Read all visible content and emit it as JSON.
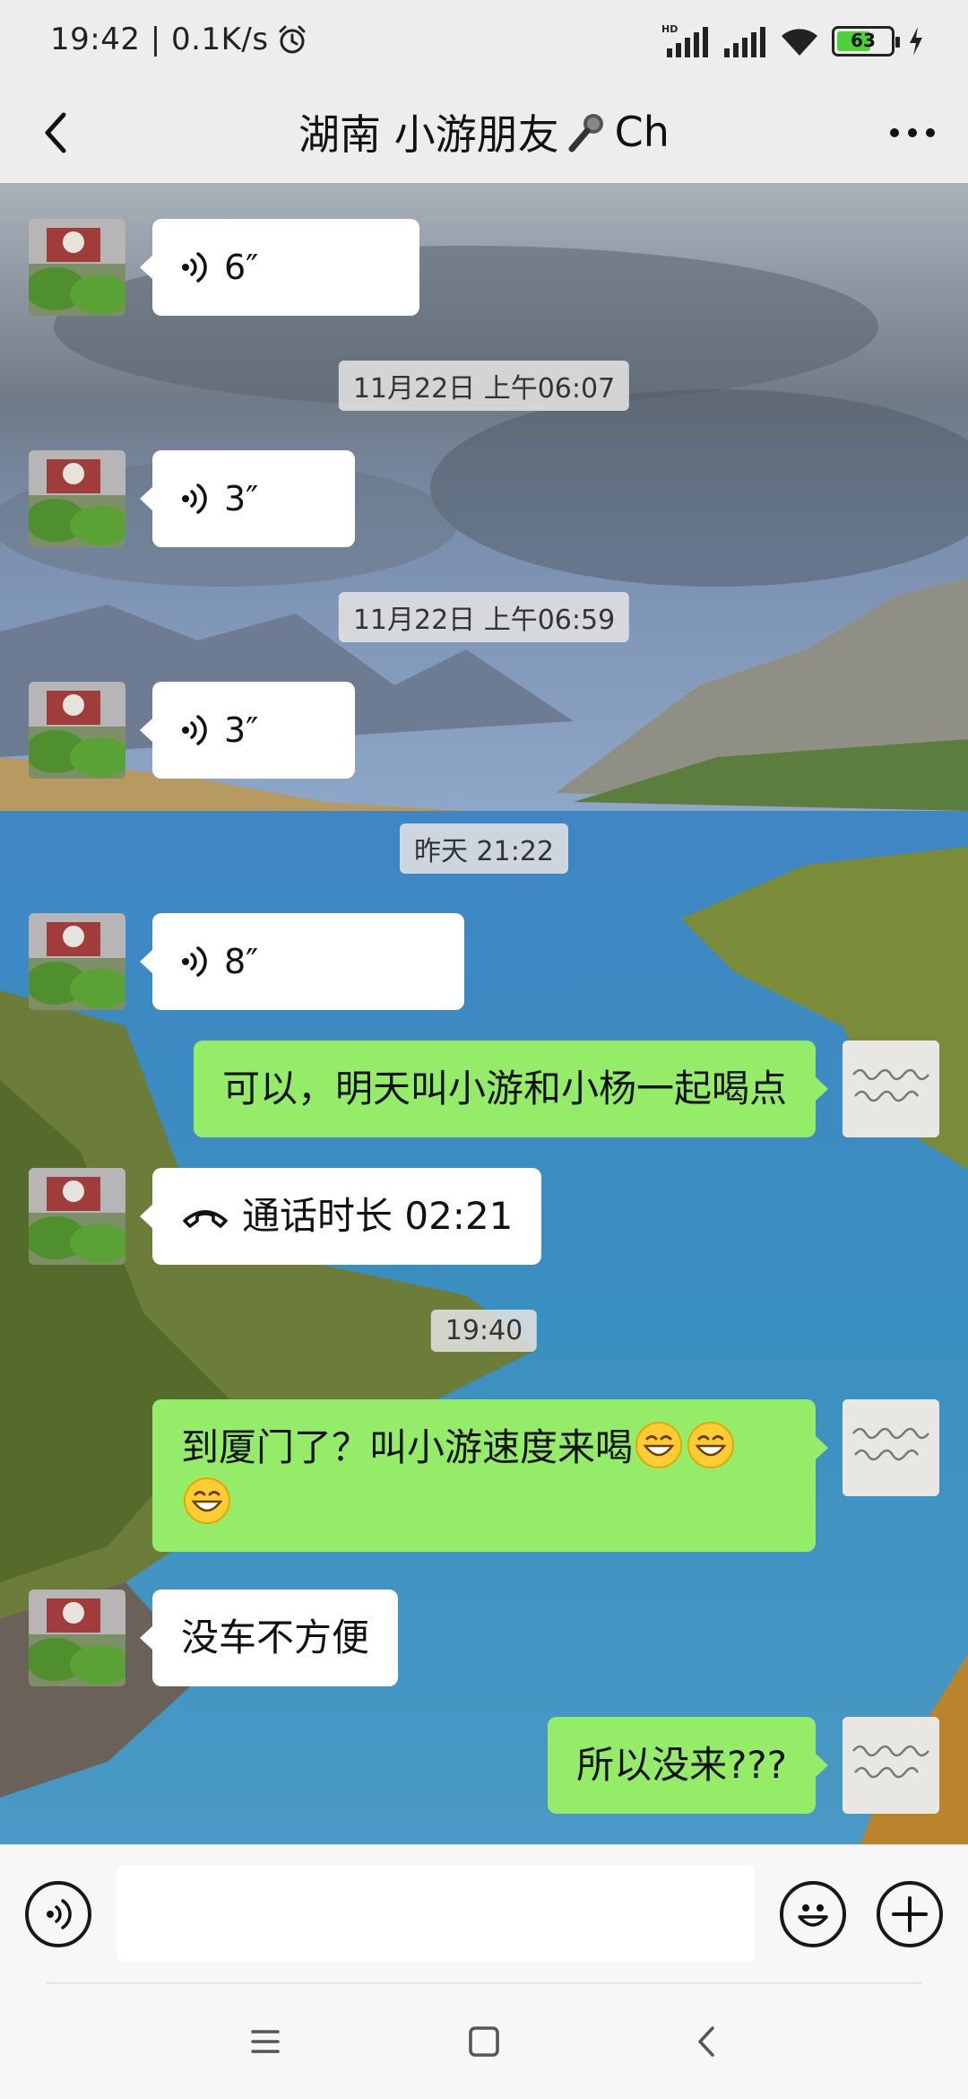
{
  "status_bar": {
    "time_speed": "19:42 | 0.1K/s",
    "network_label": "HD",
    "battery_level": "63",
    "battery_fraction": 0.63
  },
  "header": {
    "title": "湖南  小游朋友 ",
    "title_suffix": "Ch",
    "title_icon": "microphone-emoji",
    "back_icon": "back-chevron-icon",
    "more_icon": "more-dots-icon"
  },
  "messages": [
    {
      "type": "voice",
      "direction": "in",
      "duration": "6″"
    },
    {
      "type": "time",
      "text": "11月22日 上午06:07"
    },
    {
      "type": "voice",
      "direction": "in",
      "duration": "3″"
    },
    {
      "type": "time",
      "text": "11月22日 上午06:59"
    },
    {
      "type": "voice",
      "direction": "in",
      "duration": "3″"
    },
    {
      "type": "time",
      "text": "昨天 21:22"
    },
    {
      "type": "voice",
      "direction": "in",
      "duration": "8″"
    },
    {
      "type": "text",
      "direction": "out",
      "text": "可以，明天叫小游和小杨一起喝点"
    },
    {
      "type": "call",
      "direction": "in",
      "text": "通话时长 02:21"
    },
    {
      "type": "time",
      "text": "19:40"
    },
    {
      "type": "text",
      "direction": "out",
      "line1": "到厦门了？叫小游速度来喝",
      "emoji": "grinning-face-emoji"
    },
    {
      "type": "text",
      "direction": "in",
      "text": "没车不方便"
    },
    {
      "type": "text",
      "direction": "out",
      "text": "所以没来???"
    }
  ],
  "input_bar": {
    "voice_icon": "voice-input-icon",
    "emoji_icon": "emoji-icon",
    "plus_icon": "plus-icon",
    "input_value": ""
  },
  "nav_bar": {
    "menu_icon": "menu-icon",
    "home_icon": "home-icon",
    "back_icon": "back-icon"
  },
  "colors": {
    "outgoing_bubble": "#95ec69",
    "incoming_bubble": "#ffffff",
    "header_bg": "#ededed"
  }
}
